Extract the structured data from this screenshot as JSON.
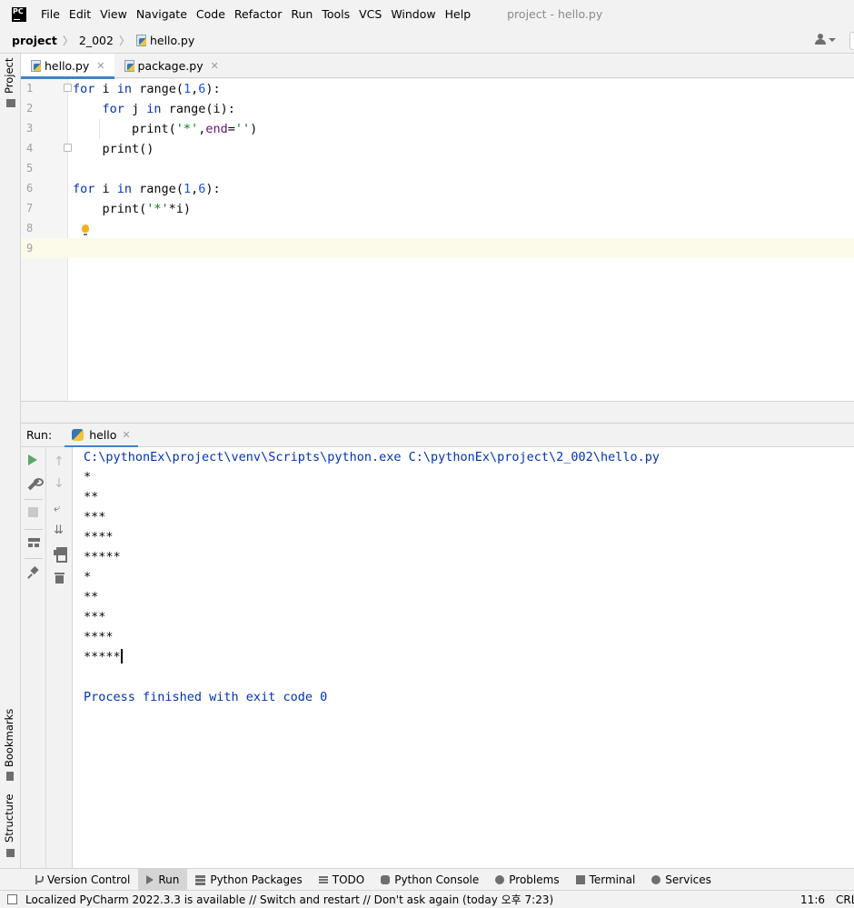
{
  "app": {
    "logo_text": "PC",
    "window_title": "project - hello.py"
  },
  "menu": [
    "File",
    "Edit",
    "View",
    "Navigate",
    "Code",
    "Refactor",
    "Run",
    "Tools",
    "VCS",
    "Window",
    "Help"
  ],
  "breadcrumb": {
    "project": "project",
    "folder": "2_002",
    "file": "hello.py"
  },
  "left_strip": {
    "project": "Project",
    "bookmarks": "Bookmarks",
    "structure": "Structure"
  },
  "editor_tabs": [
    {
      "label": "hello.py",
      "active": true
    },
    {
      "label": "package.py",
      "active": false
    }
  ],
  "line_numbers": [
    "1",
    "2",
    "3",
    "4",
    "5",
    "6",
    "7",
    "8",
    "9"
  ],
  "code": [
    [
      {
        "t": "for",
        "c": "kw"
      },
      {
        "t": " i ",
        "c": "plain"
      },
      {
        "t": "in",
        "c": "kw"
      },
      {
        "t": " ",
        "c": "plain"
      },
      {
        "t": "range",
        "c": "plain"
      },
      {
        "t": "(",
        "c": "plain"
      },
      {
        "t": "1",
        "c": "num"
      },
      {
        "t": ",",
        "c": "plain"
      },
      {
        "t": "6",
        "c": "num"
      },
      {
        "t": "):",
        "c": "plain"
      }
    ],
    [
      {
        "t": "    ",
        "c": "plain"
      },
      {
        "t": "for",
        "c": "kw"
      },
      {
        "t": " j ",
        "c": "plain"
      },
      {
        "t": "in",
        "c": "kw"
      },
      {
        "t": " range(i):",
        "c": "plain"
      }
    ],
    [
      {
        "t": "        print(",
        "c": "plain"
      },
      {
        "t": "'*'",
        "c": "str"
      },
      {
        "t": ",",
        "c": "plain"
      },
      {
        "t": "end",
        "c": "param"
      },
      {
        "t": "=",
        "c": "plain"
      },
      {
        "t": "''",
        "c": "str"
      },
      {
        "t": ")",
        "c": "plain"
      }
    ],
    [
      {
        "t": "    print()",
        "c": "plain"
      }
    ],
    [],
    [
      {
        "t": "for",
        "c": "kw"
      },
      {
        "t": " i ",
        "c": "plain"
      },
      {
        "t": "in",
        "c": "kw"
      },
      {
        "t": " range(",
        "c": "plain"
      },
      {
        "t": "1",
        "c": "num"
      },
      {
        "t": ",",
        "c": "plain"
      },
      {
        "t": "6",
        "c": "num"
      },
      {
        "t": "):",
        "c": "plain"
      }
    ],
    [
      {
        "t": "    print(",
        "c": "plain"
      },
      {
        "t": "'*'",
        "c": "str"
      },
      {
        "t": "*i)",
        "c": "plain"
      }
    ],
    [],
    []
  ],
  "run_panel": {
    "title": "Run:",
    "tab_label": "hello"
  },
  "console": {
    "command": "C:\\pythonEx\\project\\venv\\Scripts\\python.exe C:\\pythonEx\\project\\2_002\\hello.py",
    "output": [
      "*",
      "**",
      "***",
      "****",
      "*****",
      "*",
      "**",
      "***",
      "****",
      "*****"
    ],
    "exit_message": "Process finished with exit code 0"
  },
  "tool_tabs": [
    {
      "label": "Version Control",
      "icon": "branch-icon",
      "active": false
    },
    {
      "label": "Run",
      "icon": "run-icon",
      "active": true
    },
    {
      "label": "Python Packages",
      "icon": "layers-icon",
      "active": false
    },
    {
      "label": "TODO",
      "icon": "list-icon",
      "active": false
    },
    {
      "label": "Python Console",
      "icon": "python-console-icon",
      "active": false
    },
    {
      "label": "Problems",
      "icon": "problems-icon",
      "active": false
    },
    {
      "label": "Terminal",
      "icon": "terminal-icon",
      "active": false
    },
    {
      "label": "Services",
      "icon": "services-icon",
      "active": false
    }
  ],
  "status_bar": {
    "message": "Localized PyCharm 2022.3.3 is available // Switch and restart // Don't ask again (today 오후 7:23)",
    "position": "11:6",
    "line_sep": "CRLF"
  },
  "colors": {
    "accent": "#4083c9",
    "keyword": "#0033b3",
    "number": "#1750eb",
    "string": "#067d17",
    "param": "#660e7a",
    "current_line": "#fcfae8",
    "run_green": "#59a869"
  }
}
